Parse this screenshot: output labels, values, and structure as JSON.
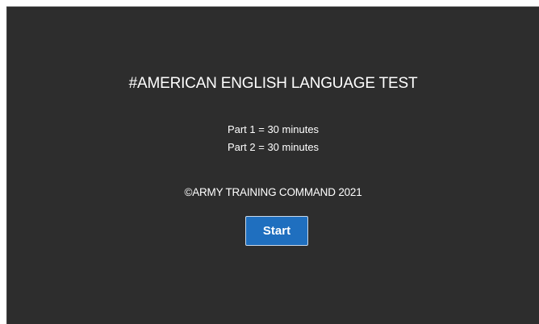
{
  "test": {
    "title": "#AMERICAN ENGLISH LANGUAGE TEST",
    "parts": [
      "Part 1 = 30 minutes",
      "Part 2 = 30 minutes"
    ],
    "copyright": "©ARMY TRAINING COMMAND 2021",
    "start_label": "Start"
  },
  "colors": {
    "background": "#2d2d2d",
    "text": "#ffffff",
    "button": "#1f6fbf"
  }
}
